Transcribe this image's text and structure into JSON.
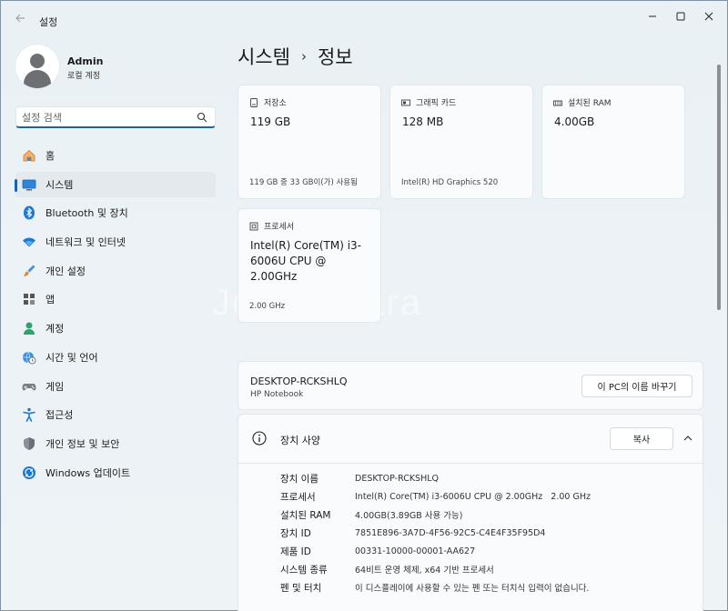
{
  "app": {
    "title": "설정"
  },
  "profile": {
    "name": "Admin",
    "account_type": "로컬 계정"
  },
  "search": {
    "placeholder": "설정 검색"
  },
  "nav": {
    "items": [
      {
        "label": "홈",
        "icon": "home-icon"
      },
      {
        "label": "시스템",
        "icon": "system-icon",
        "active": true
      },
      {
        "label": "Bluetooth 및 장치",
        "icon": "bluetooth-icon"
      },
      {
        "label": "네트워크 및 인터넷",
        "icon": "wifi-icon"
      },
      {
        "label": "개인 설정",
        "icon": "brush-icon"
      },
      {
        "label": "앱",
        "icon": "apps-icon"
      },
      {
        "label": "계정",
        "icon": "account-icon"
      },
      {
        "label": "시간 및 언어",
        "icon": "globe-clock-icon"
      },
      {
        "label": "게임",
        "icon": "gamepad-icon"
      },
      {
        "label": "접근성",
        "icon": "accessibility-icon"
      },
      {
        "label": "개인 정보 및 보안",
        "icon": "shield-icon"
      },
      {
        "label": "Windows 업데이트",
        "icon": "update-icon"
      }
    ]
  },
  "breadcrumb": {
    "parent": "시스템",
    "separator": "›",
    "current": "정보"
  },
  "cards": {
    "storage": {
      "title": "저장소",
      "value": "119 GB",
      "detail": "119 GB 중 33 GB이(가) 사용됨"
    },
    "graphics": {
      "title": "그래픽 카드",
      "value": "128 MB",
      "detail": "Intel(R) HD Graphics 520"
    },
    "ram": {
      "title": "설치된 RAM",
      "value": "4.00GB"
    },
    "processor": {
      "title": "프로세서",
      "value": "Intel(R) Core(TM) i3-6006U CPU @ 2.00GHz",
      "detail": "2.00 GHz"
    }
  },
  "device": {
    "name": "DESKTOP-RCKSHLQ",
    "model": "HP Notebook",
    "rename_label": "이 PC의 이름 바꾸기"
  },
  "specs": {
    "title": "장치 사양",
    "copy_label": "복사",
    "rows": [
      {
        "key": "장치 이름",
        "value": "DESKTOP-RCKSHLQ"
      },
      {
        "key": "프로세서",
        "value": "Intel(R) Core(TM) i3-6006U CPU @ 2.00GHz   2.00 GHz"
      },
      {
        "key": "설치된 RAM",
        "value": "4.00GB(3.89GB 사용 가능)"
      },
      {
        "key": "장치 ID",
        "value": "7851E896-3A7D-4F56-92C5-C4E4F35F95D4"
      },
      {
        "key": "제품 ID",
        "value": "00331-10000-00001-AA627"
      },
      {
        "key": "시스템 종류",
        "value": "64비트 운영 체제, x64 기반 프로세서"
      },
      {
        "key": "펜 및 터치",
        "value": "이 디스플레이에 사용할 수 있는 펜 또는 터치식 입력이 없습니다."
      }
    ]
  },
  "watermark": "Joongonara",
  "colors": {
    "accent": "#1a63ab",
    "background": "#eef3f6",
    "card": "#f9fbfc"
  }
}
